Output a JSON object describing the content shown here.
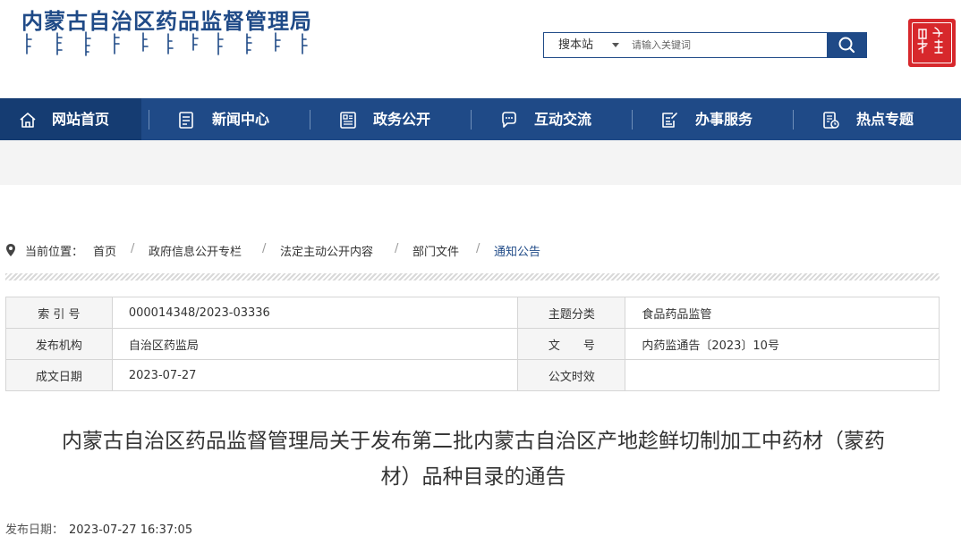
{
  "site": {
    "title": "内蒙古自治区药品监督管理局"
  },
  "search": {
    "scope_label": "搜本站",
    "placeholder": "请输入关键词"
  },
  "nav": {
    "items": [
      {
        "label": "网站首页",
        "icon": "home-icon"
      },
      {
        "label": "新闻中心",
        "icon": "news-icon"
      },
      {
        "label": "政务公开",
        "icon": "document-icon"
      },
      {
        "label": "互动交流",
        "icon": "chat-icon"
      },
      {
        "label": "办事服务",
        "icon": "service-icon"
      },
      {
        "label": "热点专题",
        "icon": "topic-icon"
      }
    ]
  },
  "breadcrumb": {
    "prefix": "当前位置：",
    "items": [
      "首页",
      "政府信息公开专栏",
      "法定主动公开内容",
      "部门文件",
      "通知公告"
    ],
    "separator": "/"
  },
  "info": {
    "rows": [
      {
        "k1": "索 引 号",
        "v1": "000014348/2023-03336",
        "k2": "主题分类",
        "v2": "食品药品监管"
      },
      {
        "k1": "发布机构",
        "v1": "自治区药监局",
        "k2": "文　　号",
        "v2": "内药监通告〔2023〕10号"
      },
      {
        "k1": "成文日期",
        "v1": "2023-07-27",
        "k2": "公文时效",
        "v2": ""
      }
    ]
  },
  "article": {
    "title_line1": "内蒙古自治区药品监督管理局关于发布第二批内蒙古自治区产地趁鲜切制加工中药材（蒙药",
    "title_line2": "材）品种目录的通告",
    "date_label": "发布日期：",
    "date_value": "2023-07-27 16:37:05"
  },
  "colors": {
    "brand_blue": "#1f4a87",
    "seal_red": "#d7282c"
  }
}
